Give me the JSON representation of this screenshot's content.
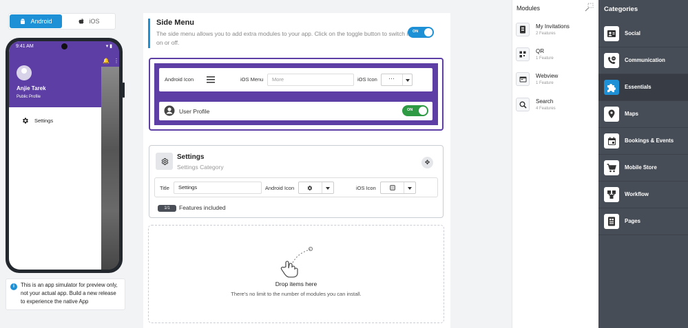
{
  "platform_tabs": {
    "android": "Android",
    "ios": "iOS",
    "active": "android"
  },
  "phone": {
    "time": "9:41 AM",
    "user_name": "Anjie Tarek",
    "user_link": "Public Profile",
    "menu_item": "Settings",
    "header_color": "#5c3ea5"
  },
  "simulator_note": "This is an app simulator for preview only, not your actual app. Build a new release to experience the native App",
  "side_menu": {
    "title": "Side Menu",
    "description": "The side menu allows you to add extra modules to your app. Click on the toggle button to switch it on or off.",
    "toggle_label": "ON",
    "android_icon_label": "Android Icon",
    "ios_menu_label": "iOS Menu",
    "ios_menu_value": "More",
    "ios_icon_label": "iOS Icon",
    "ios_icon_value": "···",
    "user_profile_label": "User Profile",
    "user_profile_toggle": "ON"
  },
  "settings_module": {
    "title": "Settings",
    "subtitle": "Settings Category",
    "title_label": "Title",
    "title_value": "Settings",
    "android_icon_label": "Android Icon",
    "ios_icon_label": "iOS Icon",
    "features_badge": "1/1",
    "features_text": "Features included"
  },
  "dropzone": {
    "title": "Drop items here",
    "description": "There's no limit to the number of modules you can install."
  },
  "modules": {
    "title": "Modules",
    "items": [
      {
        "name": "My Invitations",
        "count": "2 Features",
        "icon": "invitation-icon"
      },
      {
        "name": "QR",
        "count": "1 Feature",
        "icon": "qr-icon"
      },
      {
        "name": "Webview",
        "count": "1 Feature",
        "icon": "webview-icon"
      },
      {
        "name": "Search",
        "count": "4 Features",
        "icon": "search-icon"
      }
    ]
  },
  "categories": {
    "title": "Categories",
    "active": "Essentials",
    "items": [
      {
        "label": "Social",
        "icon": "social-icon"
      },
      {
        "label": "Communication",
        "icon": "communication-icon"
      },
      {
        "label": "Essentials",
        "icon": "puzzle-icon"
      },
      {
        "label": "Maps",
        "icon": "map-pin-icon"
      },
      {
        "label": "Bookings & Events",
        "icon": "calendar-icon"
      },
      {
        "label": "Mobile Store",
        "icon": "cart-icon"
      },
      {
        "label": "Workflow",
        "icon": "workflow-icon"
      },
      {
        "label": "Pages",
        "icon": "pages-icon"
      }
    ]
  },
  "colors": {
    "accent": "#1e90d6",
    "purple": "#5c3ea5",
    "toggle_green": "#2e9a43",
    "sidebar_dark": "#474d56"
  }
}
